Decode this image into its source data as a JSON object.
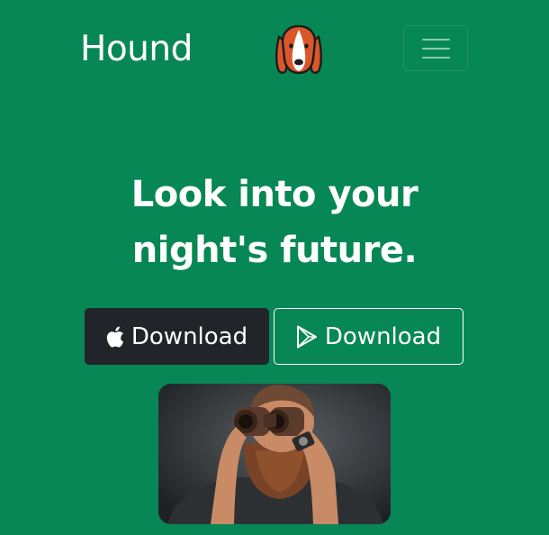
{
  "navbar": {
    "brand": "Hound",
    "logo_icon": "basset-hound-logo-icon",
    "menu_icon": "hamburger-menu-icon"
  },
  "hero": {
    "headline_line1": "Look into your",
    "headline_line2": "night's future.",
    "apple_button": {
      "icon": "apple-icon",
      "label": "Download"
    },
    "play_button": {
      "icon": "google-play-icon",
      "label": "Download"
    },
    "photo": "bearded-man-looking-through-binoculars-photo"
  },
  "colors": {
    "background": "#078755",
    "dark_button": "#212529",
    "text": "#ffffff",
    "logo_orange": "#d9572a"
  }
}
